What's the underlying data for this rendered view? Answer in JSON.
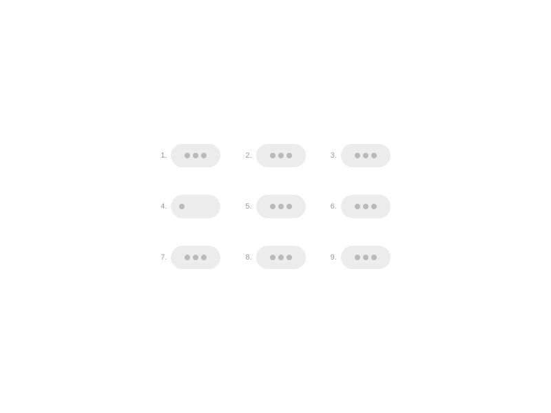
{
  "items": [
    {
      "label": "1.",
      "dots": 3,
      "variant": "normal"
    },
    {
      "label": "2.",
      "dots": 3,
      "variant": "normal"
    },
    {
      "label": "3.",
      "dots": 3,
      "variant": "normal"
    },
    {
      "label": "4.",
      "dots": 1,
      "variant": "single"
    },
    {
      "label": "5.",
      "dots": 3,
      "variant": "normal"
    },
    {
      "label": "6.",
      "dots": 3,
      "variant": "normal"
    },
    {
      "label": "7.",
      "dots": 3,
      "variant": "normal"
    },
    {
      "label": "8.",
      "dots": 3,
      "variant": "normal"
    },
    {
      "label": "9.",
      "dots": 3,
      "variant": "normal"
    }
  ]
}
